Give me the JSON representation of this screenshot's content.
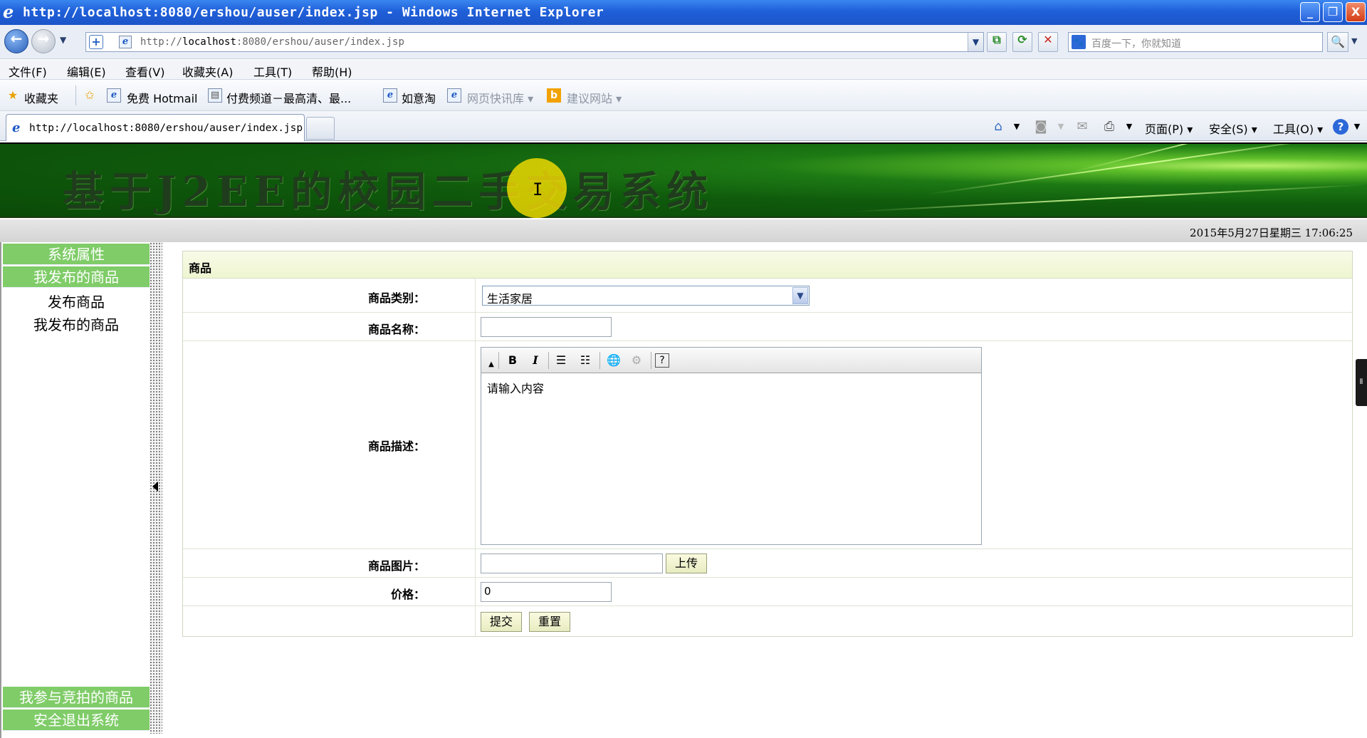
{
  "window": {
    "title": "http://localhost:8080/ershou/auser/index.jsp - Windows Internet Explorer",
    "btn_min": "_",
    "btn_max": "❐",
    "btn_close": "X"
  },
  "address": {
    "url_prefix": "http://",
    "url_host": "localhost",
    "url_rest": ":8080/ershou/auser/index.jsp",
    "search_placeholder": "百度一下，你就知道"
  },
  "menu": [
    "文件(F)",
    "编辑(E)",
    "查看(V)",
    "收藏夹(A)",
    "工具(T)",
    "帮助(H)"
  ],
  "favorites": {
    "favorites_label": "收藏夹",
    "items": [
      "免费 Hotmail",
      "付费频道－最高清、最...",
      "如意淘",
      "网页快讯库 ▾",
      "建议网站 ▾"
    ]
  },
  "tab": {
    "label": "http://localhost:8080/ershou/auser/index.jsp"
  },
  "commandbar": {
    "page": "页面(P) ▾",
    "safety": "安全(S) ▾",
    "tools": "工具(O) ▾"
  },
  "banner": {
    "title": "基于J2EE的校园二手交易系统"
  },
  "datetime": "2015年5月27日星期三  17:06:25",
  "sidebar": {
    "sections": [
      "系统属性",
      "我发布的商品"
    ],
    "links": [
      "发布商品",
      "我发布的商品"
    ],
    "bottom_sections": [
      "我参与竞拍的商品",
      "安全退出系统"
    ]
  },
  "form": {
    "header": "商品",
    "category_label": "商品类别：",
    "category_value": "生活家居",
    "name_label": "商品名称：",
    "name_value": "",
    "desc_label": "商品描述：",
    "desc_placeholder": "请输入内容",
    "image_label": "商品图片：",
    "image_value": "",
    "upload_button": "上传",
    "price_label": "价格：",
    "price_value": "0",
    "submit_button": "提交",
    "reset_button": "重置"
  },
  "editor_toolbar": {
    "bold": "B",
    "italic": "I"
  }
}
